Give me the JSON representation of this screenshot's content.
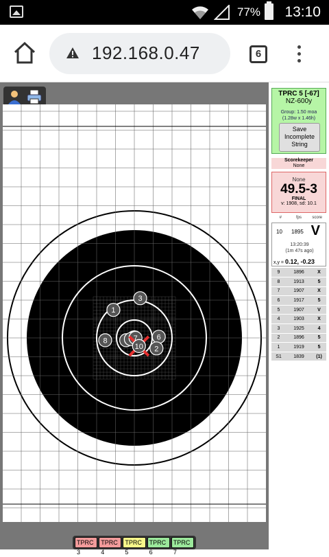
{
  "status": {
    "battery": "77%",
    "time": "13:10"
  },
  "browser": {
    "url": "192.168.0.47",
    "tab_count": "6"
  },
  "info": {
    "relay": "TPRC 5 [-67]",
    "course": "NZ-600y",
    "group_line1": "Group: 1.50 moa",
    "group_line2": "(1.28w x 1.46h)",
    "save_line1": "Save",
    "save_line2": "Incomplete",
    "save_line3": "String"
  },
  "scorekeeper": {
    "label": "Scorekeeper",
    "value": "None"
  },
  "score": {
    "name": "None",
    "total": "49.5-3",
    "status": "FINAL",
    "stats": "v: 1908, sd: 10.1"
  },
  "shot_header": [
    "#",
    "fps",
    "score"
  ],
  "last_shot": {
    "num": "10",
    "fps": "1895",
    "score": "V",
    "time": "13:20:39",
    "ago": "(1m 47s ago)"
  },
  "xy": {
    "label": "x,y =",
    "value": "0.12, -0.23 moa"
  },
  "shots": [
    {
      "n": "9",
      "fps": "1896",
      "score": "X"
    },
    {
      "n": "8",
      "fps": "1913",
      "score": "5"
    },
    {
      "n": "7",
      "fps": "1907",
      "score": "X"
    },
    {
      "n": "6",
      "fps": "1917",
      "score": "5"
    },
    {
      "n": "5",
      "fps": "1907",
      "score": "V"
    },
    {
      "n": "4",
      "fps": "1903",
      "score": "X"
    },
    {
      "n": "3",
      "fps": "1925",
      "score": "4"
    },
    {
      "n": "2",
      "fps": "1896",
      "score": "5"
    },
    {
      "n": "1",
      "fps": "1919",
      "score": "5"
    },
    {
      "n": "S1",
      "fps": "1839",
      "score": "(1)"
    }
  ],
  "relays": [
    {
      "label": "TPRC 3",
      "color": "#f29b9b"
    },
    {
      "label": "TPRC 4",
      "color": "#f29b9b"
    },
    {
      "label": "TPRC 5",
      "color": "#f7f78a"
    },
    {
      "label": "TPRC 6",
      "color": "#9be89b"
    },
    {
      "label": "TPRC 7",
      "color": "#9be89b"
    }
  ],
  "target_shots": [
    {
      "label": "1",
      "x": -0.9,
      "y": 1.2
    },
    {
      "label": "3",
      "x": 0.25,
      "y": 1.7
    },
    {
      "label": "8",
      "x": -1.25,
      "y": -0.1
    },
    {
      "label": "9",
      "x": -0.35,
      "y": -0.1
    },
    {
      "label": "5",
      "x": -0.05,
      "y": 0.0
    },
    {
      "label": "4",
      "x": -0.15,
      "y": -0.05
    },
    {
      "label": "7",
      "x": 0.05,
      "y": 0.0
    },
    {
      "label": "6",
      "x": 1.05,
      "y": 0.05
    },
    {
      "label": "2",
      "x": 0.95,
      "y": -0.45
    },
    {
      "label": "10",
      "x": 0.2,
      "y": -0.35
    }
  ]
}
